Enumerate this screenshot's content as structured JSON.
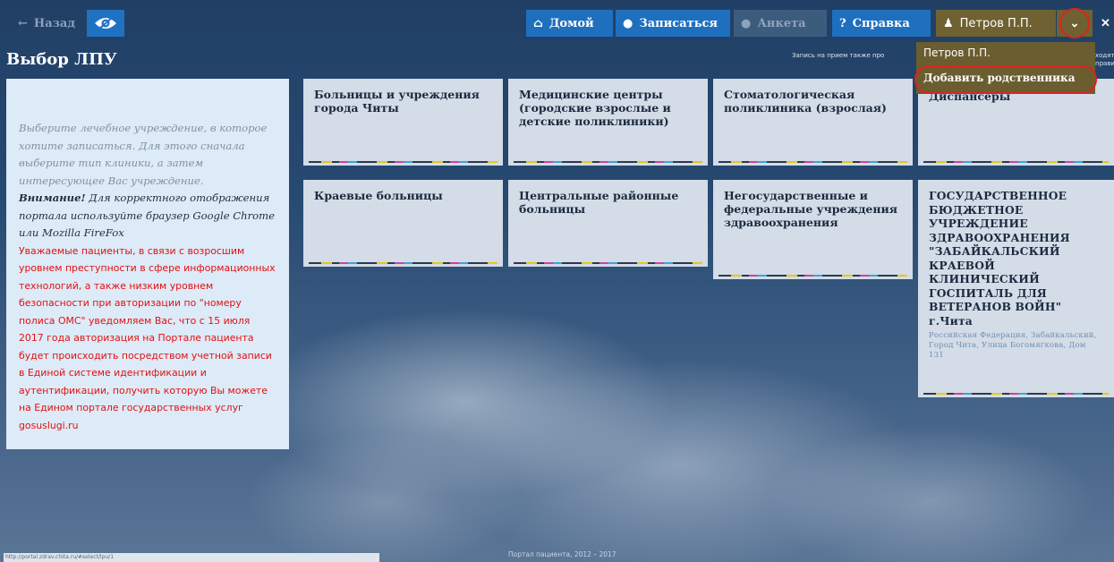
{
  "topbar": {
    "back_label": "Назад",
    "home_label": "Домой",
    "signup_label": "Записаться",
    "profile_label": "Анкета",
    "help_label": "Справка",
    "user_label": "Петров П.П."
  },
  "user_menu": {
    "items": [
      "Петров П.П.",
      "Добавить родственника"
    ]
  },
  "page": {
    "title": "Выбор ЛПУ",
    "notice": "Запись на прием также про",
    "right_edge_text": "ходятся правил"
  },
  "info": {
    "intro": "Выберите лечебное учреждение, в которое хотите записаться. Для этого сначала выберите тип клиники, а затем интересующее Вас учреждение.",
    "warning_title": "Внимание!",
    "warning_text": "Для корректного отображения портала используйте браузер Google Chrome или Mozilla FireFox",
    "red_text": "Уважаемые пациенты, в связи с возросшим уровнем преступности в сфере информационных технологий, а также низким уровнем безопасности при авторизации по \"номеру полиса ОМС\" уведомляем Вас, что с 15 июля 2017 года авторизация на Портале пациента будет происходить посредством учетной записи в Единой системе идентификации и аутентификации, получить которую Вы можете на Едином портале государственных услуг gosuslugi.ru"
  },
  "cards": [
    {
      "title": "Больницы и учреждения города Читы"
    },
    {
      "title": "Медицинские центры (городские взрослые и детские поликлиники)"
    },
    {
      "title": "Стоматологическая поликлиника (взрослая)"
    },
    {
      "title": "Диспансеры"
    },
    {
      "title": "Краевые больницы"
    },
    {
      "title": "Центральные районные больницы"
    },
    {
      "title": "Негосударственные и федеральные учреждения здравоохранения"
    },
    {
      "title": "ГОСУДАРСТВЕННОЕ БЮДЖЕТНОЕ УЧРЕЖДЕНИЕ ЗДРАВООХРАНЕНИЯ \"ЗАБАЙКАЛЬСКИЙ КРАЕВОЙ КЛИНИЧЕСКИЙ ГОСПИТАЛЬ ДЛЯ ВЕТЕРАНОВ ВОЙН\" г.Чита",
      "address": "Российская Федерация, Забайкальский, Город Чита, Улица Богомягкова, Дом 131"
    }
  ],
  "footer": {
    "url": "http://portal.zdrav.chita.ru/#select/lpu/1",
    "copyright": "Портал пациента, 2012 – 2017"
  },
  "colors": {
    "accent": "#1f6fbf",
    "user_menu": "#6f6131",
    "highlight_ring": "#dd2222",
    "warning_red": "#e01212"
  }
}
